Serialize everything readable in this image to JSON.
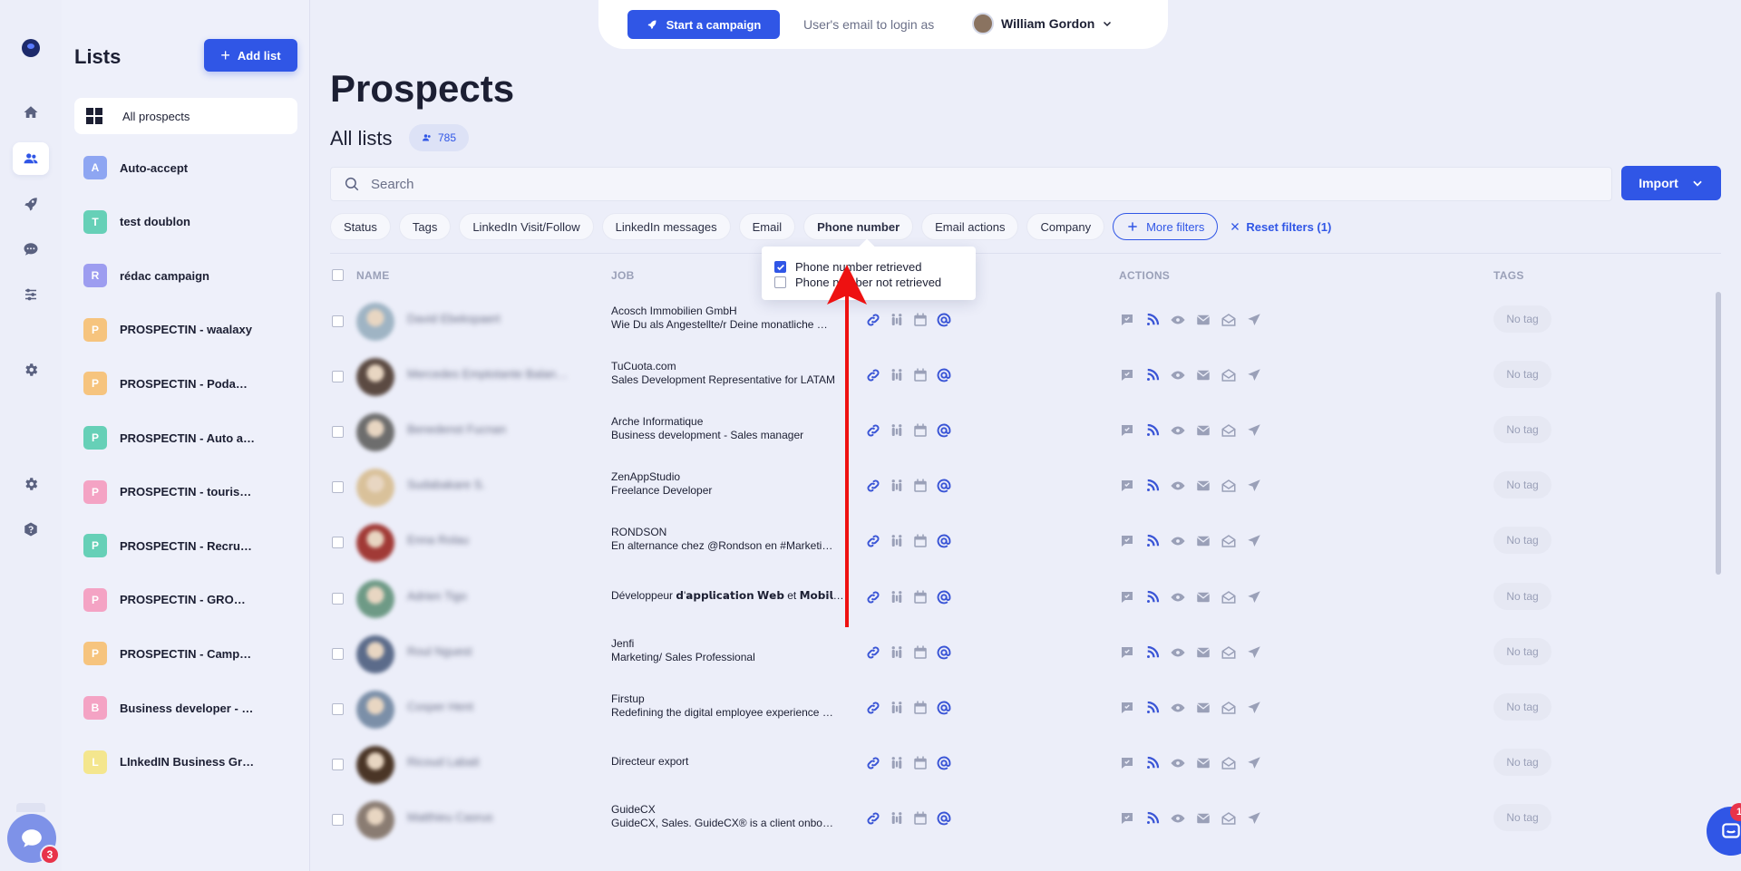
{
  "colors": {
    "accent": "#3056e6",
    "background": "#eceef9",
    "badge": "#e8334a",
    "arrow": "#ee1111"
  },
  "nav": {
    "items": [
      {
        "icon": "home-icon"
      },
      {
        "icon": "users-icon",
        "active": true
      },
      {
        "icon": "rocket-icon"
      },
      {
        "icon": "chat-icon"
      },
      {
        "icon": "sliders-icon"
      },
      {
        "icon": "gear-icon"
      },
      {
        "icon": "settings-icon"
      },
      {
        "icon": "help-icon"
      }
    ],
    "support_badge": "3"
  },
  "lists_panel": {
    "title": "Lists",
    "add_button": "Add list",
    "items": [
      {
        "label": "All prospects",
        "avatar": "",
        "color": "",
        "active": true
      },
      {
        "label": "Auto-accept",
        "avatar": "A",
        "color": "#8ea6f2"
      },
      {
        "label": "test doublon",
        "avatar": "T",
        "color": "#66d0b7"
      },
      {
        "label": "rédac campaign",
        "avatar": "R",
        "color": "#9d9df0"
      },
      {
        "label": "PROSPECTIN - waalaxy",
        "avatar": "P",
        "color": "#f6c47e"
      },
      {
        "label": "PROSPECTIN - Podaw…",
        "avatar": "P",
        "color": "#f6c47e"
      },
      {
        "label": "PROSPECTIN - Auto a…",
        "avatar": "P",
        "color": "#66d0b7"
      },
      {
        "label": "PROSPECTIN - tourisme",
        "avatar": "P",
        "color": "#f4a3c4"
      },
      {
        "label": "PROSPECTIN - Recrut…",
        "avatar": "P",
        "color": "#66d0b7"
      },
      {
        "label": "PROSPECTIN - GROW…",
        "avatar": "P",
        "color": "#f4a3c4"
      },
      {
        "label": "PROSPECTIN - Camp…",
        "avatar": "P",
        "color": "#f6c47e"
      },
      {
        "label": "Business developer - …",
        "avatar": "B",
        "color": "#f4a3c4"
      },
      {
        "label": "LInkedIN Business Gr…",
        "avatar": "L",
        "color": "#f4e68e"
      }
    ]
  },
  "topbar": {
    "start_campaign": "Start a campaign",
    "login_as": "User's email to login as",
    "user_name": "William Gordon"
  },
  "page": {
    "title": "Prospects",
    "subtitle": "All lists",
    "count": "785"
  },
  "search": {
    "placeholder": "Search"
  },
  "import_button": "Import",
  "filters": {
    "chips": [
      "Status",
      "Tags",
      "LinkedIn Visit/Follow",
      "LinkedIn messages",
      "Email",
      "Phone number",
      "Email actions",
      "Company"
    ],
    "selected": "Phone number",
    "more_filters": "More filters",
    "reset": "Reset filters (1)"
  },
  "phone_dropdown": {
    "options": [
      {
        "label": "Phone number retrieved",
        "checked": true
      },
      {
        "label": "Phone number not retrieved",
        "checked": false
      }
    ]
  },
  "table": {
    "columns": {
      "name": "NAME",
      "job": "JOB",
      "actions": "ACTIONS",
      "tags": "TAGS"
    },
    "rows": [
      {
        "name": "David Ebekspaert",
        "company": "Acosch Immobilien GmbH",
        "title": "Wie Du als Angestellte/r Deine monatliche …",
        "tag": "No tag",
        "photo": "#9fb4c4"
      },
      {
        "name": "Mercedes Emptotante Balan…",
        "company": "TuCuota.com",
        "title": "Sales Development Representative for LATAM",
        "tag": "No tag",
        "photo": "#5b4a42"
      },
      {
        "name": "Benedenst Fucnan",
        "company": "Arche Informatique",
        "title": "Business development - Sales manager",
        "tag": "No tag",
        "photo": "#6d6d6d"
      },
      {
        "name": "Sudabakare S.",
        "company": "ZenAppStudio",
        "title": "Freelance Developer",
        "tag": "No tag",
        "photo": "#d9c19a"
      },
      {
        "name": "Enna Rolau",
        "company": "RONDSON",
        "title": "En alternance chez @Rondson en #Marketi…",
        "tag": "No tag",
        "photo": "#a13a36"
      },
      {
        "name": "Adrien Tigo",
        "company": "",
        "title": "Développeur 𝗱'𝗮𝗽𝗽𝗹𝗶𝗰𝗮𝘁𝗶𝗼𝗻 𝗪𝗲𝗯 et 𝗠𝗼𝗯𝗶𝗹…",
        "tag": "No tag",
        "photo": "#6e9a86"
      },
      {
        "name": "Roul Nguest",
        "company": "Jenfi",
        "title": "Marketing/ Sales Professional",
        "tag": "No tag",
        "photo": "#5b6b8a"
      },
      {
        "name": "Cosper Hent",
        "company": "Firstup",
        "title": "Redefining the digital employee experience …",
        "tag": "No tag",
        "photo": "#7b8fa8"
      },
      {
        "name": "Ricoud Labait",
        "company": "",
        "title": "Directeur export",
        "tag": "No tag",
        "photo": "#4a3526"
      },
      {
        "name": "Matthieu Casrus",
        "company": "GuideCX",
        "title": "GuideCX, Sales. GuideCX® is a client onbo…",
        "tag": "No tag",
        "photo": "#8a7c72"
      }
    ]
  },
  "help_chat": {
    "badge": "1"
  }
}
